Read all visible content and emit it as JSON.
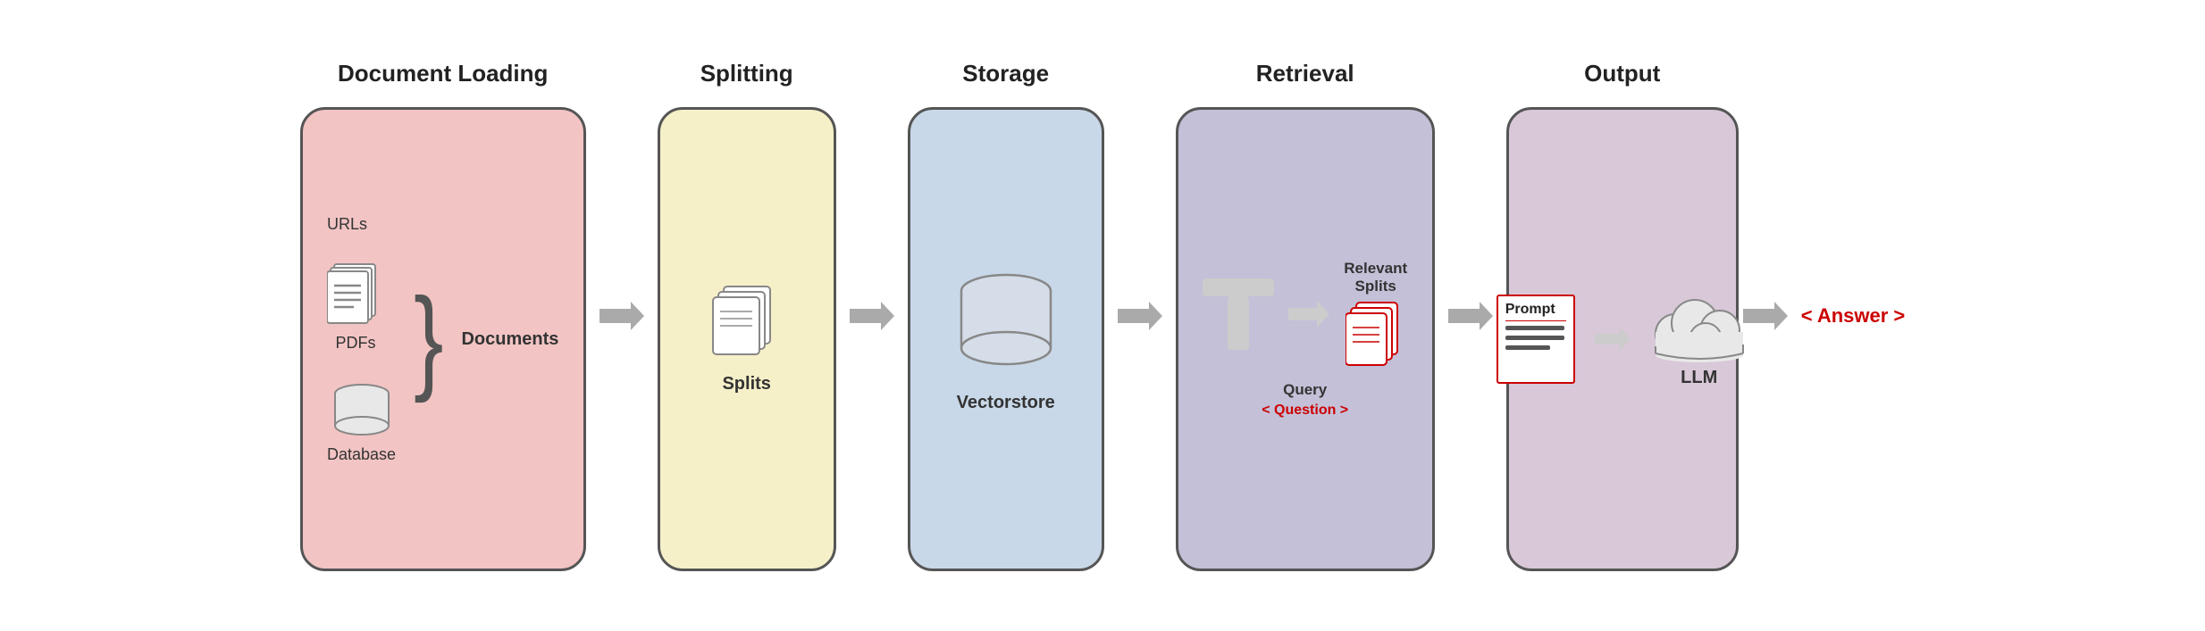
{
  "diagram": {
    "stages": [
      {
        "id": "doc-loading",
        "title": "Document Loading",
        "sources": [
          {
            "label": "URLs"
          },
          {
            "label": "PDFs"
          },
          {
            "label": "Database"
          }
        ],
        "documents_label": "Documents"
      },
      {
        "id": "splitting",
        "title": "Splitting",
        "splits_label": "Splits"
      },
      {
        "id": "storage",
        "title": "Storage",
        "vectorstore_label": "Vectorstore"
      },
      {
        "id": "retrieval",
        "title": "Retrieval",
        "relevant_splits_label": "Relevant\nSplits",
        "query_label": "Query",
        "question_label": "< Question >"
      },
      {
        "id": "output",
        "title": "Output",
        "prompt_label": "Prompt",
        "llm_label": "LLM",
        "answer_label": "< Answer >"
      }
    ],
    "arrows": [
      "->",
      "->",
      "->",
      "->",
      "->"
    ]
  }
}
